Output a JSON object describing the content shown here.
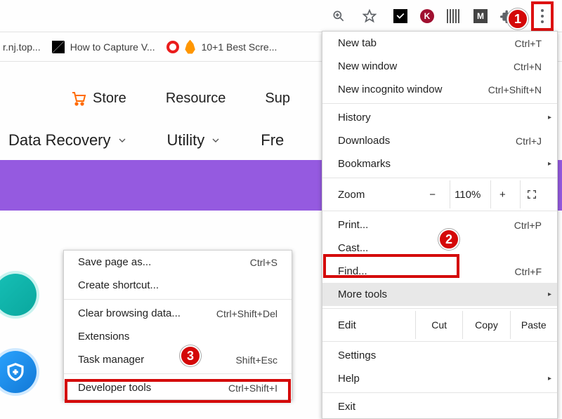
{
  "toolbar": {
    "kebab": "⋮"
  },
  "bookmarks": [
    {
      "label": "r.nj.top..."
    },
    {
      "label": "How to Capture V..."
    },
    {
      "label": "10+1 Best Scre..."
    }
  ],
  "page": {
    "nav1": [
      {
        "label": "Store",
        "icon": "cart"
      },
      {
        "label": "Resource"
      },
      {
        "label": "Sup"
      }
    ],
    "nav2": [
      {
        "label": "Data Recovery",
        "submenu": true
      },
      {
        "label": "Utility",
        "submenu": true
      },
      {
        "label": "Fre"
      }
    ]
  },
  "main_menu": {
    "new_tab": {
      "label": "New tab",
      "shortcut": "Ctrl+T"
    },
    "new_window": {
      "label": "New window",
      "shortcut": "Ctrl+N"
    },
    "new_incognito": {
      "label": "New incognito window",
      "shortcut": "Ctrl+Shift+N"
    },
    "history": {
      "label": "History"
    },
    "downloads": {
      "label": "Downloads",
      "shortcut": "Ctrl+J"
    },
    "bookmarks": {
      "label": "Bookmarks"
    },
    "zoom": {
      "label": "Zoom",
      "minus": "−",
      "value": "110%",
      "plus": "+"
    },
    "print": {
      "label": "Print...",
      "shortcut": "Ctrl+P"
    },
    "cast": {
      "label": "Cast..."
    },
    "find": {
      "label": "Find...",
      "shortcut": "Ctrl+F"
    },
    "more_tools": {
      "label": "More tools"
    },
    "edit": {
      "label": "Edit",
      "cut": "Cut",
      "copy": "Copy",
      "paste": "Paste"
    },
    "settings": {
      "label": "Settings"
    },
    "help": {
      "label": "Help"
    },
    "exit": {
      "label": "Exit"
    }
  },
  "sub_menu": {
    "save_page": {
      "label": "Save page as...",
      "shortcut": "Ctrl+S"
    },
    "create_shortcut": {
      "label": "Create shortcut..."
    },
    "clear_data": {
      "label": "Clear browsing data...",
      "shortcut": "Ctrl+Shift+Del"
    },
    "extensions": {
      "label": "Extensions"
    },
    "task_manager": {
      "label": "Task manager",
      "shortcut": "Shift+Esc"
    },
    "devtools": {
      "label": "Developer tools",
      "shortcut": "Ctrl+Shift+I"
    }
  },
  "markers": {
    "m1": "1",
    "m2": "2",
    "m3": "3"
  }
}
